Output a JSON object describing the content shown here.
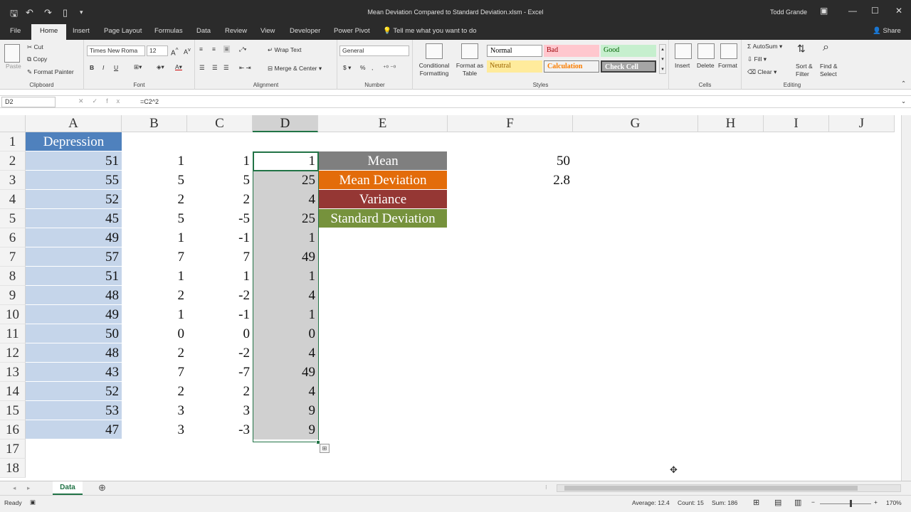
{
  "window": {
    "title": "Mean Deviation Compared to Standard Deviation.xlsm - Excel",
    "user": "Todd Grande"
  },
  "tabs": [
    "File",
    "Home",
    "Insert",
    "Page Layout",
    "Formulas",
    "Data",
    "Review",
    "View",
    "Developer",
    "Power Pivot"
  ],
  "tell_me": "Tell me what you want to do",
  "share": "Share",
  "ribbon": {
    "clipboard": {
      "paste": "Paste",
      "cut": "Cut",
      "copy": "Copy",
      "format_painter": "Format Painter",
      "label": "Clipboard"
    },
    "font": {
      "name": "Times New Roma",
      "size": "12",
      "label": "Font",
      "bold": "B",
      "italic": "I",
      "underline": "U"
    },
    "alignment": {
      "wrap": "Wrap Text",
      "merge": "Merge & Center",
      "label": "Alignment"
    },
    "number": {
      "format": "General",
      "label": "Number"
    },
    "styles": {
      "conditional": "Conditional Formatting",
      "format_table": "Format as Table",
      "normal": "Normal",
      "bad": "Bad",
      "good": "Good",
      "neutral": "Neutral",
      "calculation": "Calculation",
      "check": "Check Cell",
      "label": "Styles"
    },
    "cells": {
      "insert": "Insert",
      "delete": "Delete",
      "format": "Format",
      "label": "Cells"
    },
    "editing": {
      "autosum": "AutoSum",
      "fill": "Fill",
      "clear": "Clear",
      "sort": "Sort & Filter",
      "find": "Find & Select",
      "label": "Editing"
    }
  },
  "formula_bar": {
    "name_box": "D2",
    "formula": "=C2^2"
  },
  "columns": [
    "A",
    "B",
    "C",
    "D",
    "E",
    "F",
    "G",
    "H",
    "I",
    "J"
  ],
  "rows": [
    "1",
    "2",
    "3",
    "4",
    "5",
    "6",
    "7",
    "8",
    "9",
    "10",
    "11",
    "12",
    "13",
    "14",
    "15",
    "16",
    "17",
    "18"
  ],
  "header_A1": "Depression",
  "colA": [
    "51",
    "55",
    "52",
    "45",
    "49",
    "57",
    "51",
    "48",
    "49",
    "50",
    "48",
    "43",
    "52",
    "53",
    "47"
  ],
  "colB": [
    "1",
    "5",
    "2",
    "5",
    "1",
    "7",
    "1",
    "2",
    "1",
    "0",
    "2",
    "7",
    "2",
    "3",
    "3"
  ],
  "colC": [
    "1",
    "5",
    "2",
    "-5",
    "-1",
    "7",
    "1",
    "-2",
    "-1",
    "0",
    "-2",
    "-7",
    "2",
    "3",
    "-3"
  ],
  "colD": [
    "1",
    "25",
    "4",
    "25",
    "1",
    "49",
    "1",
    "4",
    "1",
    "0",
    "4",
    "49",
    "4",
    "9",
    "9"
  ],
  "labels": [
    {
      "text": "Mean",
      "color": "#7f7f7f"
    },
    {
      "text": "Mean Deviation",
      "color": "#e36c0a"
    },
    {
      "text": "Variance",
      "color": "#953734"
    },
    {
      "text": "Standard Deviation",
      "color": "#76923c"
    }
  ],
  "colF": [
    "50",
    "2.8"
  ],
  "sheet_tab": "Data",
  "status": {
    "ready": "Ready",
    "average": "Average: 12.4",
    "count": "Count: 15",
    "sum": "Sum: 186",
    "zoom": "170%"
  }
}
